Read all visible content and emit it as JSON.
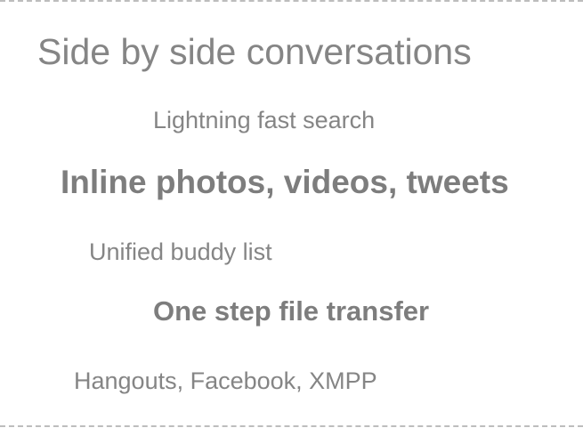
{
  "features": {
    "side_by_side": "Side by side conversations",
    "search": "Lightning fast search",
    "inline_media": "Inline photos, videos, tweets",
    "buddy_list": "Unified buddy list",
    "file_transfer": "One step file transfer",
    "protocols": "Hangouts, Facebook, XMPP"
  }
}
